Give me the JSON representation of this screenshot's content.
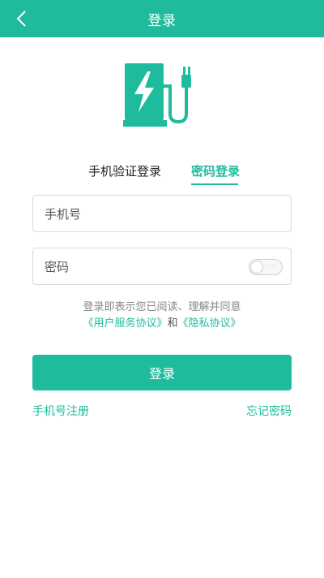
{
  "header": {
    "title": "登录"
  },
  "tabs": {
    "sms_login": "手机验证登录",
    "password_login": "密码登录"
  },
  "form": {
    "phone_placeholder": "手机号",
    "password_placeholder": "密码"
  },
  "agreement": {
    "line1": "登录即表示您已阅读、理解并同意",
    "user_agreement": "《用户服务协议》",
    "and": "和",
    "privacy_policy": "《隐私协议》"
  },
  "actions": {
    "login_label": "登录",
    "register_label": "手机号注册",
    "forgot_label": "忘记密码"
  },
  "colors": {
    "accent": "#1ebc9d"
  },
  "icons": {
    "back": "chevron-left-icon",
    "logo": "charging-station-icon",
    "password_toggle": "visibility-toggle"
  }
}
